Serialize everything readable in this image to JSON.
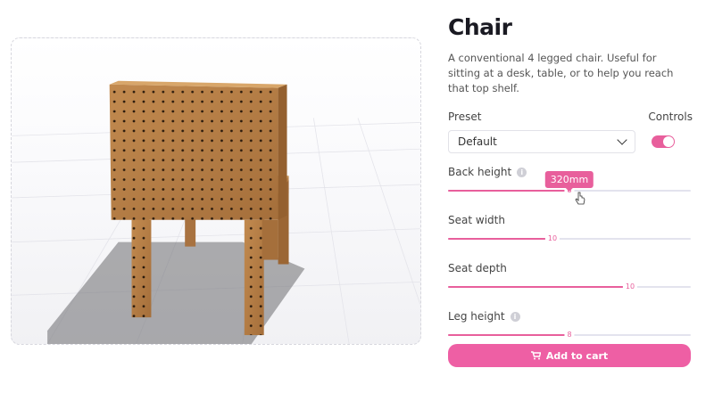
{
  "product": {
    "title": "Chair",
    "description": "A conventional 4 legged chair. Useful for sitting at a desk, table, or to help you reach that top shelf."
  },
  "preset": {
    "label": "Preset",
    "value": "Default"
  },
  "controls": {
    "label": "Controls",
    "enabled": true
  },
  "sliders": [
    {
      "label": "Back height",
      "value": "8",
      "fraction": 0.5,
      "tooltip": "320mm",
      "has_info": true
    },
    {
      "label": "Seat width",
      "value": "10",
      "fraction": 0.43,
      "has_info": false
    },
    {
      "label": "Seat depth",
      "value": "10",
      "fraction": 0.75,
      "has_info": false
    },
    {
      "label": "Leg height",
      "value": "8",
      "fraction": 0.5,
      "has_info": true
    }
  ],
  "cart": {
    "label": "Add to cart",
    "icon": "cart-icon"
  },
  "colors": {
    "accent": "#e85f9c",
    "button": "#ee5fa4",
    "wood": "#b07a44"
  }
}
